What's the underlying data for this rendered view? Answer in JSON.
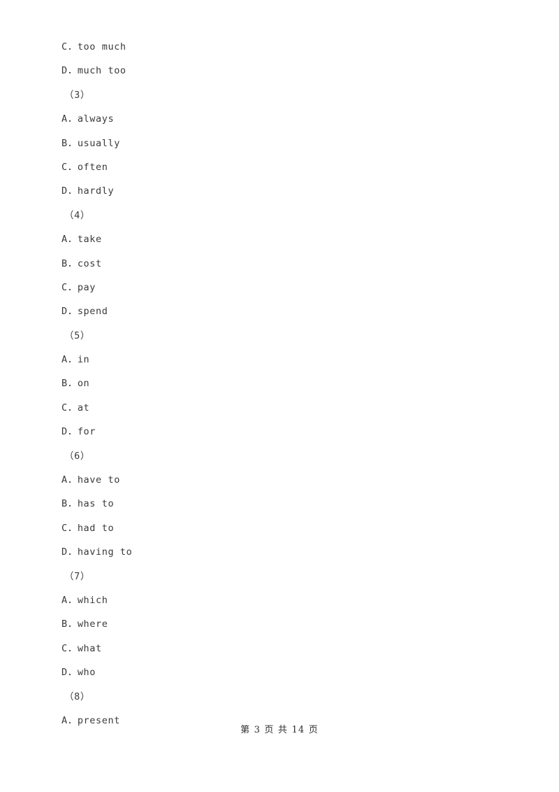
{
  "document": {
    "type": "exam-answer-options-page",
    "background_color": "#ffffff",
    "text_color": "#3a3a3a"
  },
  "lines": [
    {
      "kind": "option",
      "text": "C．too much"
    },
    {
      "kind": "option",
      "text": "D．much too"
    },
    {
      "kind": "question",
      "text": "（3）"
    },
    {
      "kind": "option",
      "text": "A．always"
    },
    {
      "kind": "option",
      "text": "B．usually"
    },
    {
      "kind": "option",
      "text": "C．often"
    },
    {
      "kind": "option",
      "text": "D．hardly"
    },
    {
      "kind": "question",
      "text": "（4）"
    },
    {
      "kind": "option",
      "text": "A．take"
    },
    {
      "kind": "option",
      "text": "B．cost"
    },
    {
      "kind": "option",
      "text": "C．pay"
    },
    {
      "kind": "option",
      "text": "D．spend"
    },
    {
      "kind": "question",
      "text": "（5）"
    },
    {
      "kind": "option",
      "text": "A．in"
    },
    {
      "kind": "option",
      "text": "B．on"
    },
    {
      "kind": "option",
      "text": "C．at"
    },
    {
      "kind": "option",
      "text": "D．for"
    },
    {
      "kind": "question",
      "text": "（6）"
    },
    {
      "kind": "option",
      "text": "A．have to"
    },
    {
      "kind": "option",
      "text": "B．has to"
    },
    {
      "kind": "option",
      "text": "C．had to"
    },
    {
      "kind": "option",
      "text": "D．having to"
    },
    {
      "kind": "question",
      "text": "（7）"
    },
    {
      "kind": "option",
      "text": "A．which"
    },
    {
      "kind": "option",
      "text": "B．where"
    },
    {
      "kind": "option",
      "text": "C．what"
    },
    {
      "kind": "option",
      "text": "D．who"
    },
    {
      "kind": "question",
      "text": "（8）"
    },
    {
      "kind": "option",
      "text": "A．present"
    }
  ],
  "footer": {
    "text": "第 3 页 共 14 页",
    "current_page": "3",
    "total_pages": "14"
  }
}
